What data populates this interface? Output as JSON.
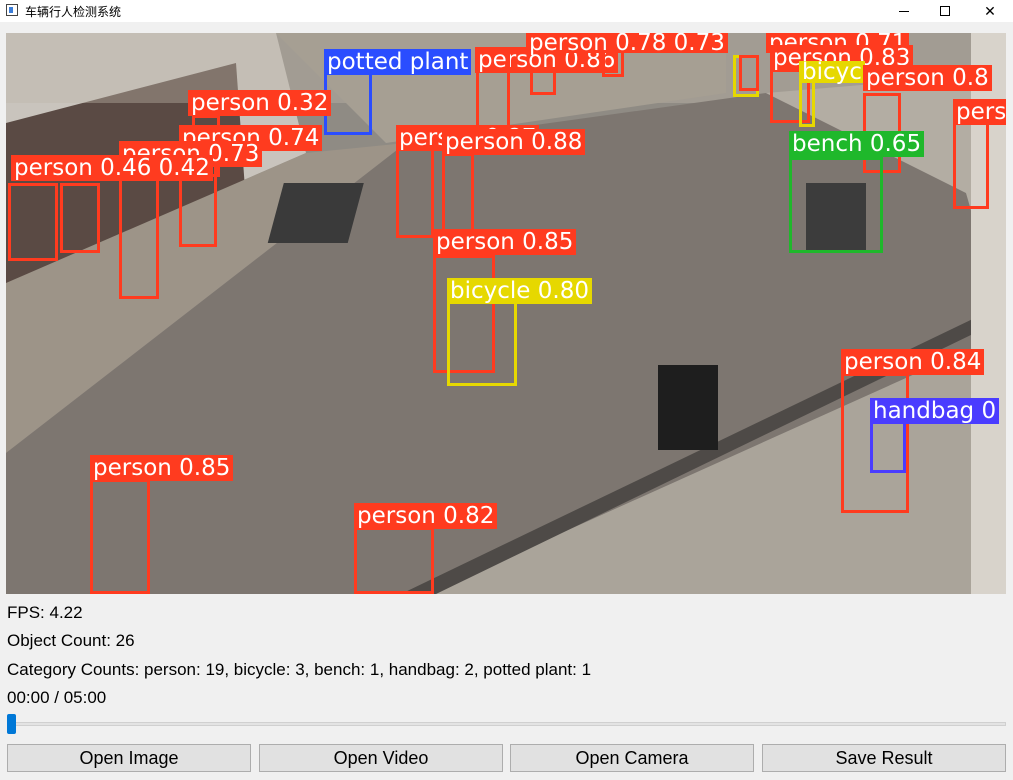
{
  "window": {
    "title": "车辆行人检测系统"
  },
  "colors": {
    "person": "#ff3b1f",
    "bicycle": "#e6d800",
    "bench": "#1fb82b",
    "handbag": "#4a3cff",
    "potted_plant": "#2a4dff"
  },
  "detections": [
    {
      "label": "person 0.86",
      "cls": "person"
    },
    {
      "label": "person 0.78 0.73",
      "cls": "person"
    },
    {
      "label": "person 0.71",
      "cls": "person"
    },
    {
      "label": "person 0.83",
      "cls": "person"
    },
    {
      "label": "person 0.8",
      "cls": "person"
    },
    {
      "label": "potted plant",
      "cls": "potted_plant"
    },
    {
      "label": "bicyc",
      "cls": "bicycle"
    },
    {
      "label": "pers",
      "cls": "person"
    },
    {
      "label": "person 0.32",
      "cls": "person"
    },
    {
      "label": "person 0.74",
      "cls": "person"
    },
    {
      "label": "person 0.73",
      "cls": "person"
    },
    {
      "label": "person 0.46 0.42",
      "cls": "person"
    },
    {
      "label": "person 0.87",
      "cls": "person"
    },
    {
      "label": "person 0.88",
      "cls": "person"
    },
    {
      "label": "bench 0.65",
      "cls": "bench"
    },
    {
      "label": "person 0.85",
      "cls": "person"
    },
    {
      "label": "bicycle 0.80",
      "cls": "bicycle"
    },
    {
      "label": "person 0.84",
      "cls": "person"
    },
    {
      "label": "handbag 0",
      "cls": "handbag"
    },
    {
      "label": "person 0.85",
      "cls": "person"
    },
    {
      "label": "person 0.82",
      "cls": "person"
    }
  ],
  "stats": {
    "fps": "FPS: 4.22",
    "object_count": "Object Count: 26",
    "category_counts": "Category Counts: person: 19, bicycle: 3, bench: 1, handbag: 2, potted plant: 1",
    "time": "00:00 / 05:00"
  },
  "progress": 0.0,
  "buttons": {
    "open_image": "Open Image",
    "open_video": "Open Video",
    "open_camera": "Open Camera",
    "save_result": "Save Result"
  }
}
